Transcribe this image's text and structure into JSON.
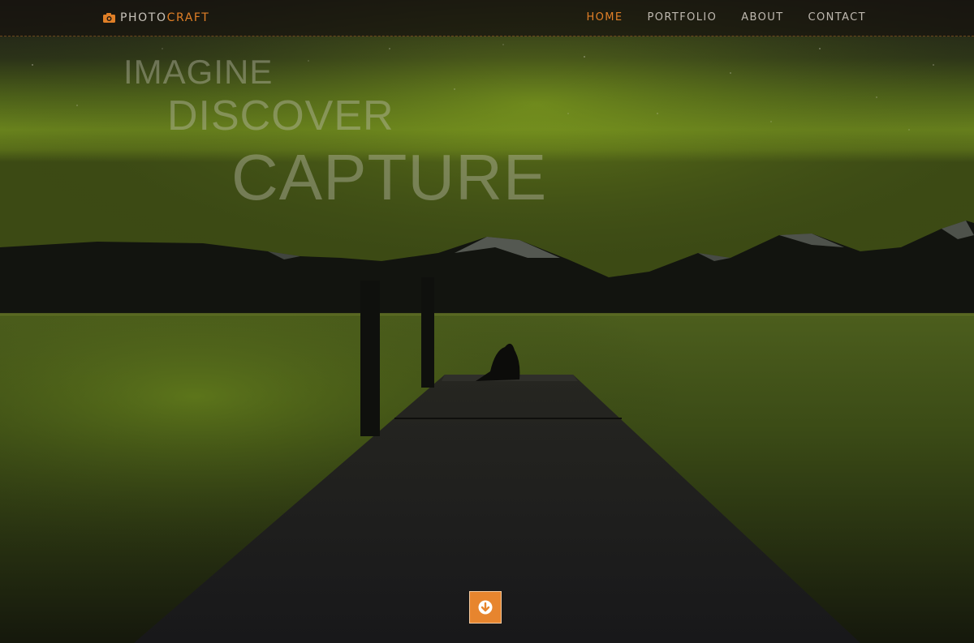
{
  "brand": {
    "part1": "PHOTO",
    "part2": "CRAFT",
    "icon": "camera-icon"
  },
  "nav": {
    "items": [
      {
        "label": "HOME",
        "active": true
      },
      {
        "label": "PORTFOLIO",
        "active": false
      },
      {
        "label": "ABOUT",
        "active": false
      },
      {
        "label": "CONTACT",
        "active": false
      }
    ]
  },
  "hero": {
    "word1": "IMAGINE",
    "word2": "DISCOVER",
    "word3": "CAPTURE",
    "image": "night-lake-aurora-pier-photo"
  },
  "scroll_button": {
    "icon": "arrow-down-circle-icon"
  },
  "colors": {
    "accent": "#e07f27",
    "nav_text": "#bfb9b0",
    "aurora": "#6e8c1e"
  }
}
